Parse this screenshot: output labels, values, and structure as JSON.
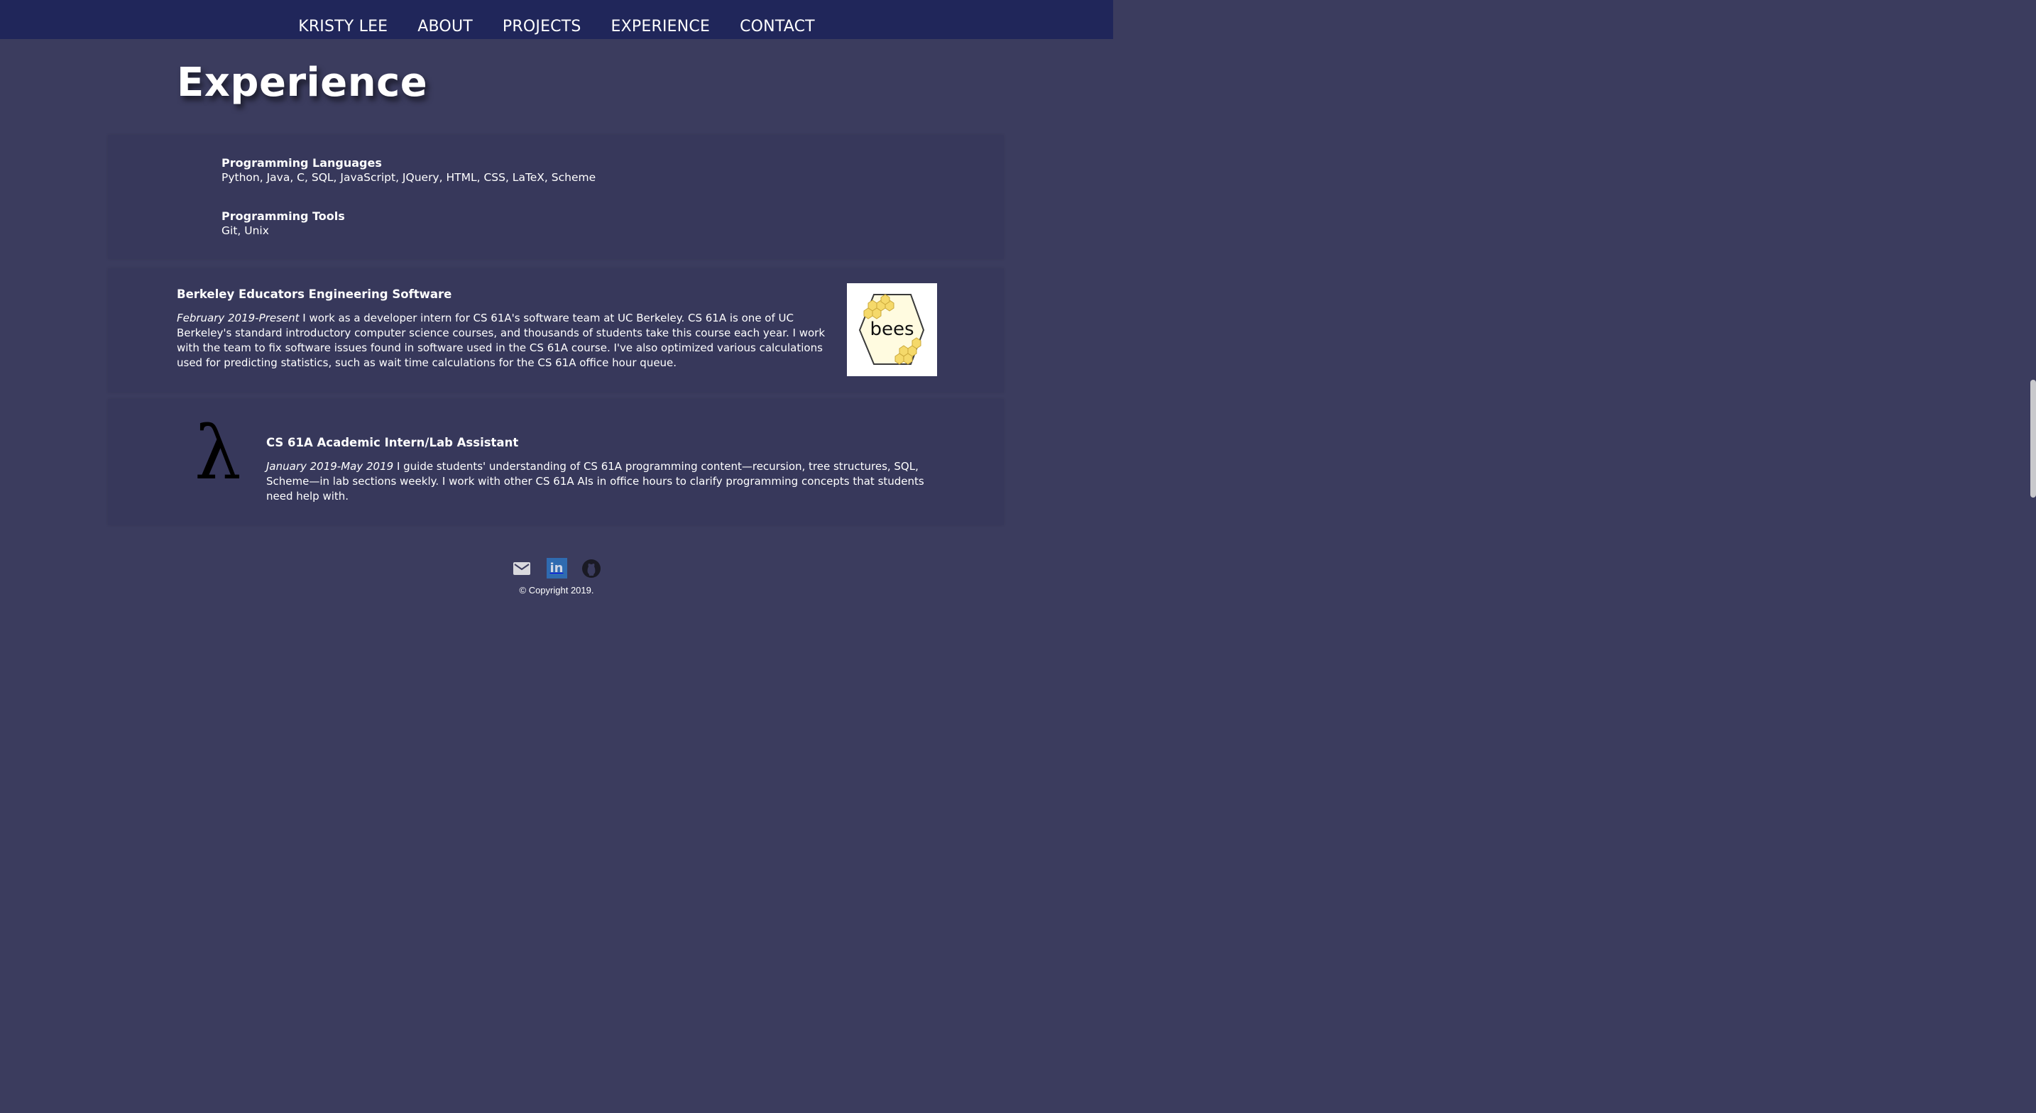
{
  "nav": {
    "items": [
      "KRISTY LEE",
      "ABOUT",
      "PROJECTS",
      "EXPERIENCE",
      "CONTACT"
    ]
  },
  "page": {
    "title": "Experience"
  },
  "skills": {
    "languages_title": "Programming Languages",
    "languages_value": "Python, Java, C, SQL, JavaScript, JQuery, HTML, CSS, LaTeX, Scheme",
    "tools_title": "Programming Tools",
    "tools_value": "Git, Unix"
  },
  "jobs": [
    {
      "title": "Berkeley Educators Engineering Software",
      "date": "February 2019-Present",
      "description": " I work as a developer intern for CS 61A's software team at UC Berkeley. CS 61A is one of UC Berkeley's standard introductory computer science courses, and thousands of students take this course each year. I work with the team to fix software issues found in software used in the CS 61A course. I've also optimized various calculations used for predicting statistics, such as wait time calculations for the CS 61A office hour queue.",
      "logo_text": "bees"
    },
    {
      "title": "CS 61A Academic Intern/Lab Assistant",
      "date": "January 2019-May 2019",
      "description": " I guide students' understanding of CS 61A programming content—recursion, tree structures, SQL, Scheme—in lab sections weekly. I work with other CS 61A AIs in office hours to clarify programming concepts that students need help with.",
      "logo_text": "λ"
    }
  ],
  "footer": {
    "icons": [
      "mail-icon",
      "linkedin-icon",
      "github-icon"
    ],
    "copyright": "© Copyright 2019."
  },
  "colors": {
    "nav_bg": "#20265a",
    "page_bg": "#3b3c5e",
    "panel_bg": "#37385b",
    "linkedin": "#2f6bb0"
  }
}
